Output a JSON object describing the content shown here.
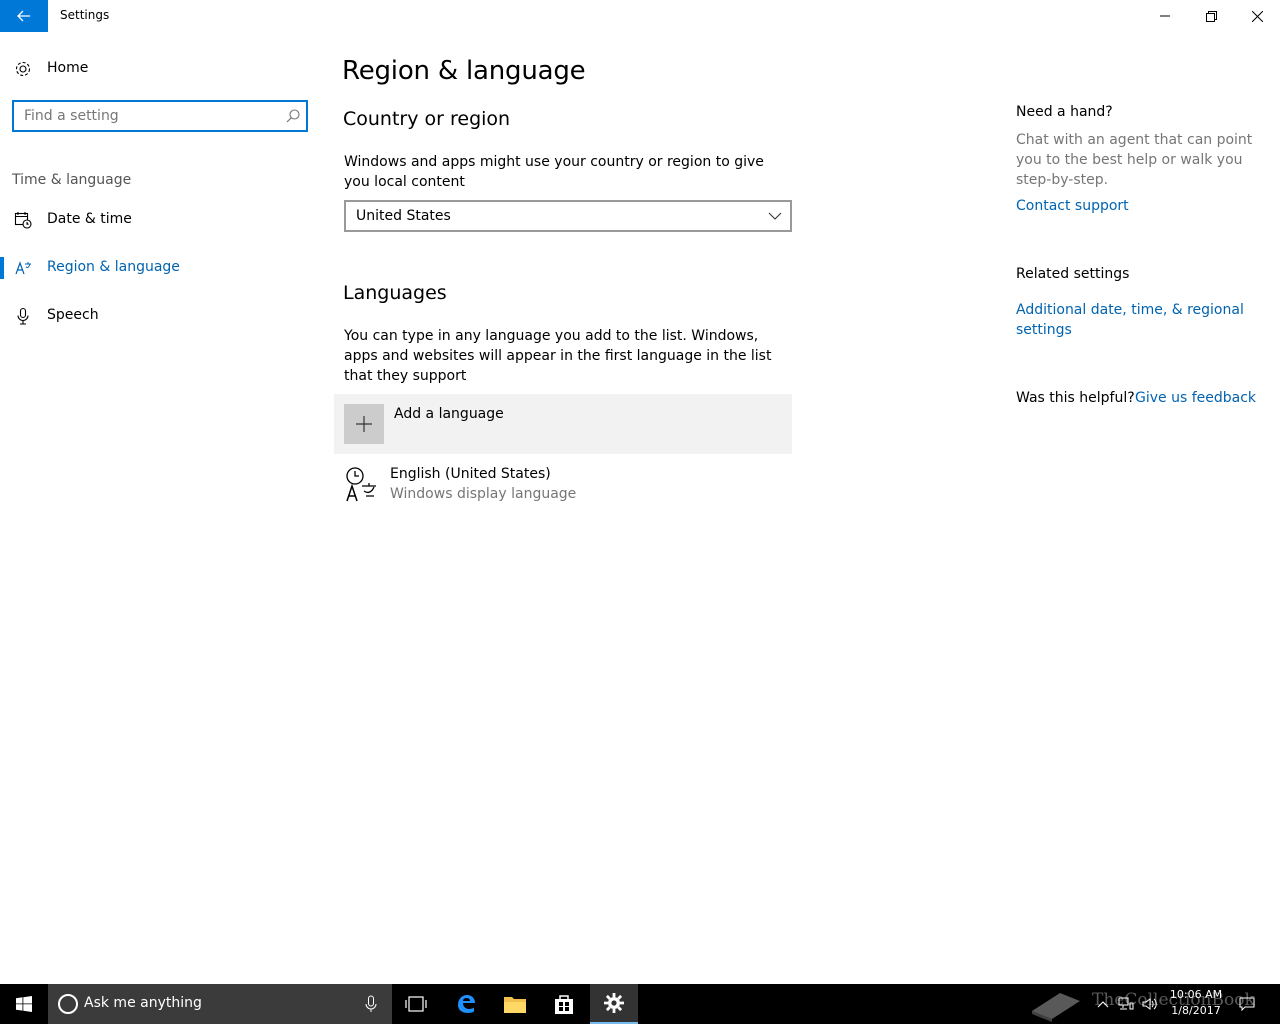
{
  "window": {
    "title": "Settings"
  },
  "sidebar": {
    "home_label": "Home",
    "search_placeholder": "Find a setting",
    "group_label": "Time & language",
    "items": [
      {
        "label": "Date & time",
        "icon": "calendar-clock-icon"
      },
      {
        "label": "Region & language",
        "icon": "region-language-icon",
        "active": true
      },
      {
        "label": "Speech",
        "icon": "microphone-icon"
      }
    ]
  },
  "main": {
    "title": "Region & language",
    "country": {
      "heading": "Country or region",
      "description": "Windows and apps might use your country or region to give you local content",
      "selected": "United States"
    },
    "languages": {
      "heading": "Languages",
      "description": "You can type in any language you add to the list. Windows, apps and websites will appear in the first language in the list that they support",
      "add_label": "Add a language",
      "list": [
        {
          "name": "English (United States)",
          "sub": "Windows display language"
        }
      ]
    }
  },
  "right": {
    "help_heading": "Need a hand?",
    "help_text": "Chat with an agent that can point you to the best help or walk you step-by-step.",
    "contact_link": "Contact support",
    "related_heading": "Related settings",
    "related_link": "Additional date, time, & regional settings",
    "feedback_question": "Was this helpful?",
    "feedback_link": "Give us feedback"
  },
  "taskbar": {
    "search_text": "Ask me anything",
    "time": "10:06 AM",
    "date": "1/8/2017",
    "watermark": "TheCollectionBook"
  },
  "colors": {
    "accent": "#0078d7",
    "link": "#0063b1",
    "taskbar": "#000000"
  }
}
